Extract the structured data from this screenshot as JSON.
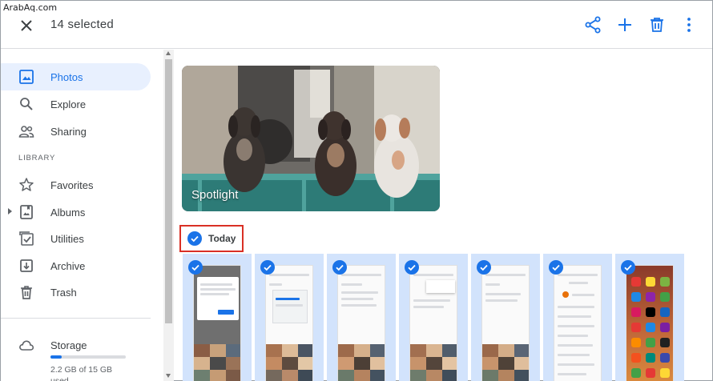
{
  "watermark": "ArabAq.com",
  "header": {
    "selection_count": "14 selected"
  },
  "sidebar": {
    "items": [
      {
        "label": "Photos",
        "icon": "photo-icon",
        "active": true
      },
      {
        "label": "Explore",
        "icon": "search-icon"
      },
      {
        "label": "Sharing",
        "icon": "people-icon"
      }
    ],
    "library_label": "LIBRARY",
    "library_items": [
      {
        "label": "Favorites",
        "icon": "star-icon"
      },
      {
        "label": "Albums",
        "icon": "album-icon"
      },
      {
        "label": "Utilities",
        "icon": "checkbox-icon"
      },
      {
        "label": "Archive",
        "icon": "archive-icon"
      },
      {
        "label": "Trash",
        "icon": "trash-icon"
      }
    ],
    "storage": {
      "label": "Storage",
      "usage": "2.2 GB of 15 GB used",
      "fraction_used": 0.147
    }
  },
  "main": {
    "spotlight_label": "Spotlight",
    "group_label": "Today"
  },
  "colors": {
    "accent": "#1a73e8",
    "selection_bg": "#d2e3fc",
    "highlight_border": "#d93025"
  }
}
